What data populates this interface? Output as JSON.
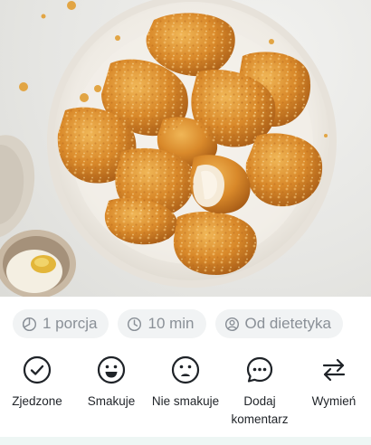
{
  "photo": {
    "subject": "breaded-chicken-nuggets",
    "plate_color": "#f4f1ec",
    "nugget_color": "#d9892a"
  },
  "chips": [
    {
      "icon": "portion-icon",
      "label": "1 porcja"
    },
    {
      "icon": "clock-icon",
      "label": "10 min"
    },
    {
      "icon": "dietitian-icon",
      "label": "Od dietetyka"
    }
  ],
  "actions": [
    {
      "icon": "check-circle-icon",
      "label": "Zjedzone"
    },
    {
      "icon": "smile-face-icon",
      "label": "Smakuje"
    },
    {
      "icon": "sad-face-icon",
      "label": "Nie smakuje"
    },
    {
      "icon": "comment-bubble-icon",
      "label": "Dodaj komentarz"
    },
    {
      "icon": "swap-arrows-icon",
      "label": "Wymień"
    }
  ],
  "colors": {
    "chip_bg": "#f1f3f4",
    "chip_text": "#8a9097",
    "bottom_strip": "#eef6f4"
  }
}
